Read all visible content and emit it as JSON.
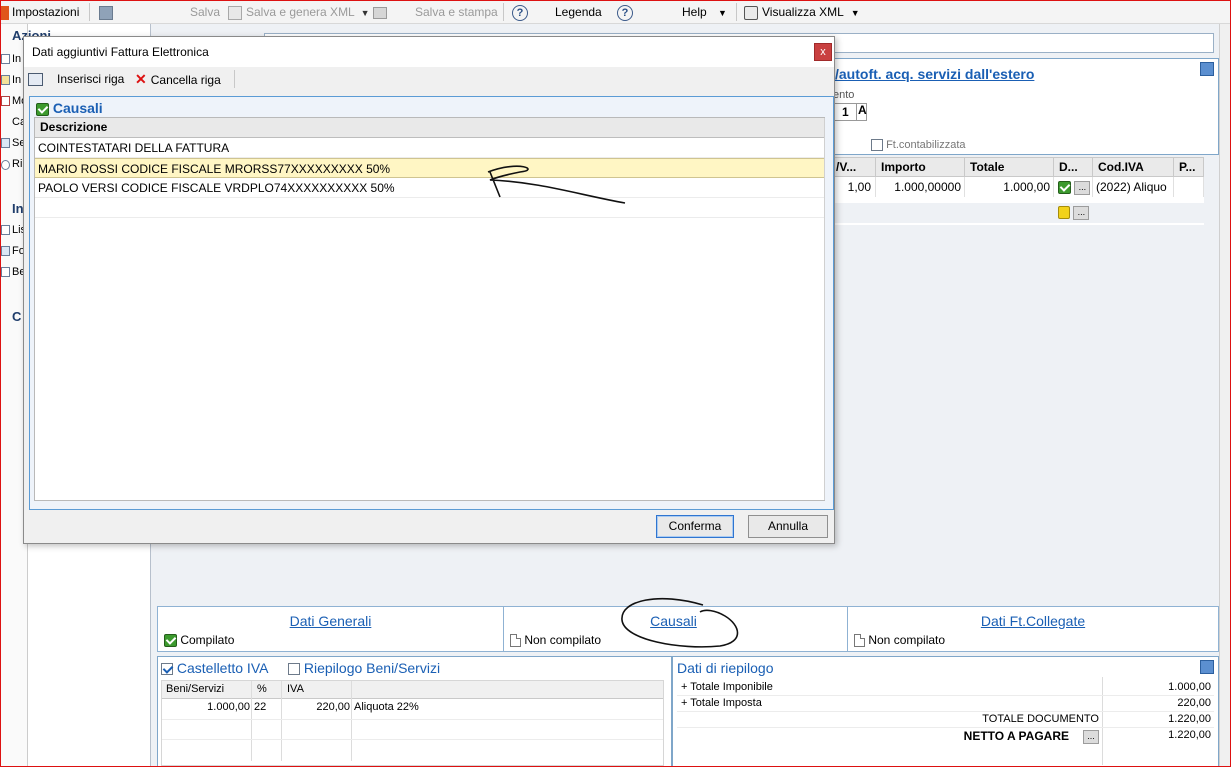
{
  "toolbar": {
    "impostazioni": "Impostazioni",
    "salva": "Salva",
    "salva_genera_xml": "Salva e genera XML",
    "salva_stampa": "Salva e stampa",
    "legenda": "Legenda",
    "help": "Help",
    "visualizza_xml": "Visualizza XML"
  },
  "leftnav": {
    "heading1": "Azioni",
    "items1": [
      "In",
      "In",
      "Mo",
      "Ca",
      "Se",
      "Ri"
    ],
    "heading2": "In",
    "items2": [
      "Lis",
      "Fo",
      "Be"
    ],
    "heading3": "C"
  },
  "document": {
    "title_link": "/autoft. acq. servizi dall'estero",
    "field_label": "ento",
    "field_value1": "1",
    "field_value2": "A",
    "ft_contabilizzata": "Ft.contabilizzata"
  },
  "lines_grid": {
    "headers": [
      "/V...",
      "Importo",
      "Totale",
      "D...",
      "Cod.IVA",
      "P..."
    ],
    "rows": [
      {
        "qty": "1,00",
        "importo": "1.000,00000",
        "totale": "1.000,00",
        "cod_iva": "(2022) Aliquo"
      }
    ]
  },
  "dialog": {
    "title": "Dati aggiuntivi Fattura Elettronica",
    "close": "x",
    "inserisci_riga": "Inserisci riga",
    "cancella_riga": "Cancella riga",
    "section": "Causali",
    "column_header": "Descrizione",
    "rows": [
      "COINTESTATARI DELLA FATTURA",
      "MARIO ROSSI CODICE FISCALE MRORSS77XXXXXXXXX 50%",
      "PAOLO VERSI CODICE FISCALE VRDPLO74XXXXXXXXXX 50%"
    ],
    "confirm": "Conferma",
    "cancel": "Annulla"
  },
  "tabs": [
    {
      "label": "Dati Generali",
      "status": "Compilato"
    },
    {
      "label": "Causali",
      "status": "Non compilato"
    },
    {
      "label": "Dati Ft.Collegate",
      "status": "Non compilato"
    }
  ],
  "castelletto": {
    "title": "Castelletto IVA",
    "riepilogo_title": "Riepilogo Beni/Servizi",
    "headers": [
      "Beni/Servizi",
      "%",
      "IVA"
    ],
    "row": {
      "beni": "1.000,00",
      "perc": "22",
      "iva": "220,00",
      "desc": "Aliquota 22%"
    }
  },
  "riepilogo": {
    "title": "Dati di riepilogo",
    "totale_imponibile_label": "+ Totale Imponibile",
    "totale_imponibile": "1.000,00",
    "totale_imposta_label": "+ Totale Imposta",
    "totale_imposta": "220,00",
    "totale_documento_label": "TOTALE DOCUMENTO",
    "totale_documento": "1.220,00",
    "netto_label": "NETTO A PAGARE",
    "netto": "1.220,00"
  },
  "colors": {
    "accent": "#1a5fb4",
    "selected_row": "#fff6c4",
    "ok": "#3c9a2e",
    "frame": "#dd1111"
  }
}
